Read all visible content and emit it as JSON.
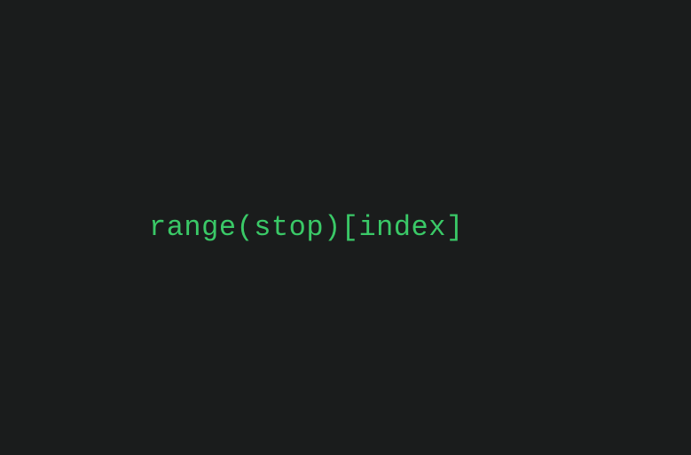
{
  "code": {
    "expression": "range(stop)[index]"
  }
}
